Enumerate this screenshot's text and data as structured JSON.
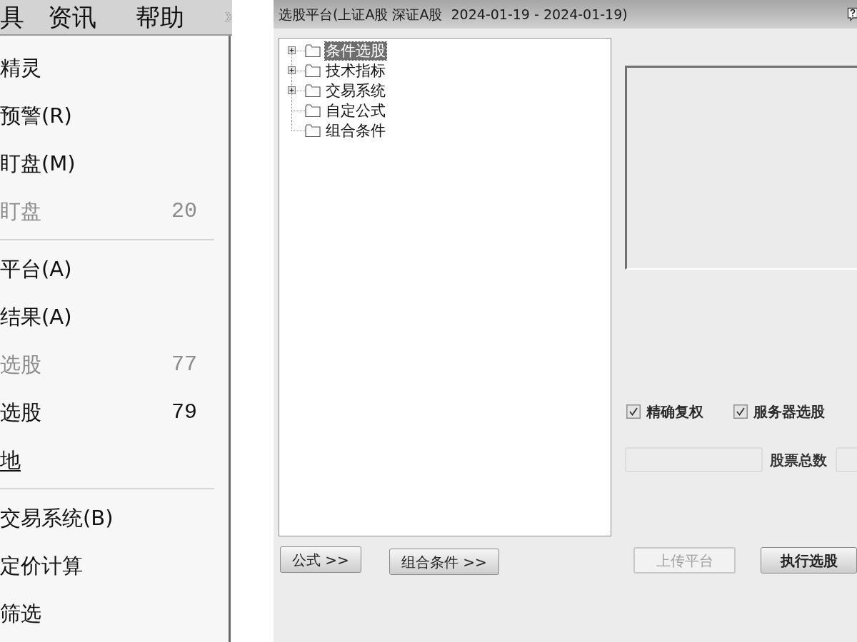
{
  "menu_bar": {
    "items": [
      {
        "label": "具"
      },
      {
        "label": "资讯"
      },
      {
        "label": "帮助"
      }
    ]
  },
  "menu": {
    "items": [
      {
        "kind": "item",
        "label": "精灵",
        "disabled": false,
        "underlined": false
      },
      {
        "kind": "item",
        "label": "预警(R)",
        "disabled": false,
        "underlined": false
      },
      {
        "kind": "item",
        "label": "盯盘(M)",
        "disabled": false,
        "underlined": false
      },
      {
        "kind": "item",
        "label": "盯盘",
        "shortcut": "20",
        "disabled": true,
        "underlined": false
      },
      {
        "kind": "separator"
      },
      {
        "kind": "item",
        "label": "平台(A)",
        "disabled": false,
        "underlined": false
      },
      {
        "kind": "item",
        "label": "结果(A)",
        "disabled": false,
        "underlined": false
      },
      {
        "kind": "item",
        "label": "选股",
        "shortcut": "77",
        "disabled": true,
        "underlined": false
      },
      {
        "kind": "item",
        "label": "选股",
        "shortcut": "79",
        "disabled": false,
        "underlined": false
      },
      {
        "kind": "item",
        "label": "地",
        "disabled": false,
        "underlined": true
      },
      {
        "kind": "separator"
      },
      {
        "kind": "item",
        "label": "交易系统(B)",
        "disabled": false,
        "underlined": false
      },
      {
        "kind": "item",
        "label": "定价计算",
        "disabled": false,
        "underlined": false
      },
      {
        "kind": "item",
        "label": "筛选",
        "disabled": false,
        "underlined": false
      }
    ]
  },
  "dialog": {
    "title": "选股平台(上证A股 深证A股  2024-01-19 - 2024-01-19)",
    "tree": [
      {
        "label": "条件选股",
        "expandable": true,
        "selected": true
      },
      {
        "label": "技术指标",
        "expandable": true,
        "selected": false
      },
      {
        "label": "交易系统",
        "expandable": true,
        "selected": false
      },
      {
        "label": "自定公式",
        "expandable": false,
        "selected": false
      },
      {
        "label": "组合条件",
        "expandable": false,
        "selected": false
      }
    ],
    "tree_buttons": [
      {
        "label": "公式 >>"
      },
      {
        "label": "组合条件 >>"
      }
    ],
    "options": [
      {
        "label": "精确复权",
        "checked": true
      },
      {
        "label": "服务器选股",
        "checked": true
      }
    ],
    "count_label": "股票总数",
    "actions": [
      {
        "label": "上传平台",
        "disabled": true
      },
      {
        "label": "执行选股",
        "disabled": false
      }
    ]
  }
}
